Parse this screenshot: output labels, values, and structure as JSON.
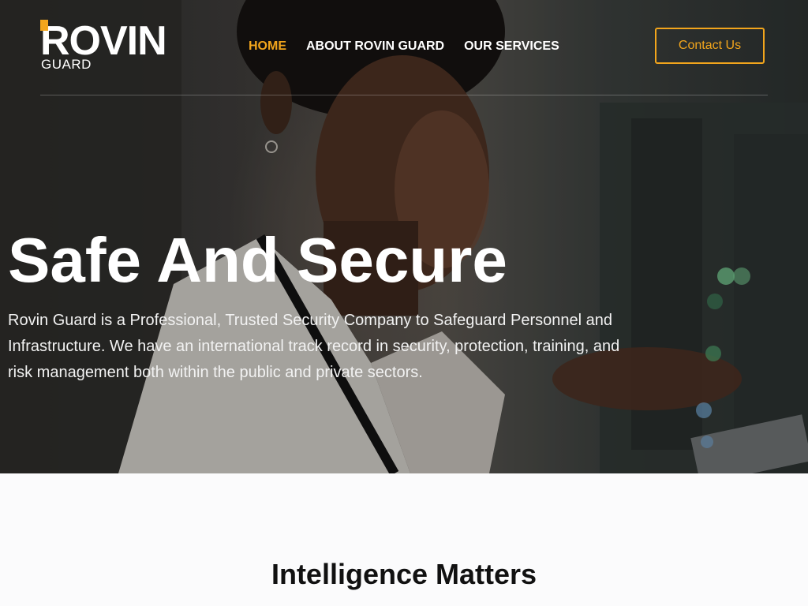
{
  "brand": {
    "name": "ROVIN",
    "sub": "GUARD",
    "accent_color": "#f2a51c"
  },
  "nav": {
    "items": [
      {
        "label": "HOME",
        "active": true
      },
      {
        "label": "ABOUT ROVIN GUARD",
        "active": false
      },
      {
        "label": "OUR SERVICES",
        "active": false
      }
    ],
    "contact_label": "Contact Us"
  },
  "hero": {
    "title": "Safe And Secure",
    "description": "Rovin Guard is a Professional, Trusted Security Company to Safeguard Personnel and Infrastructure. We have an international track record in security, protection, training, and risk management both within the public and private sectors."
  },
  "section": {
    "title": "Intelligence Matters"
  }
}
